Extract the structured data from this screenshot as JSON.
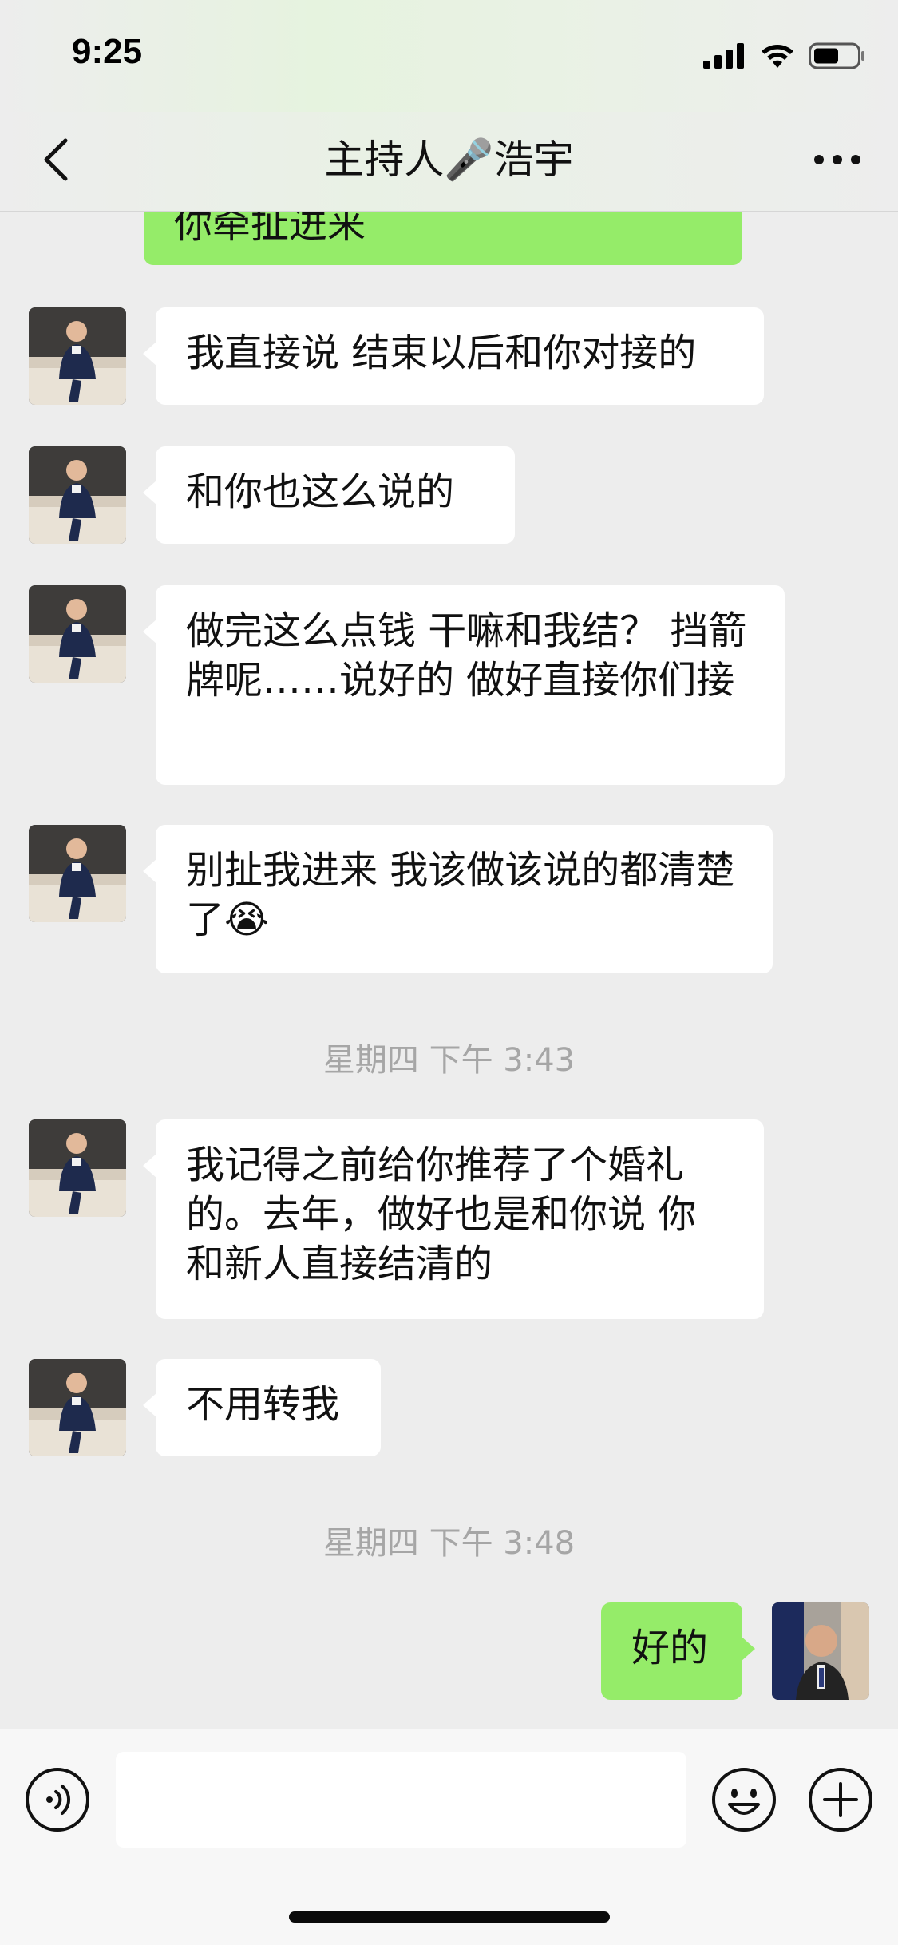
{
  "status_bar": {
    "time": "9:25"
  },
  "nav": {
    "title": "主持人🎤浩宇"
  },
  "messages": [
    {
      "side": "right",
      "text": "你牵扯进来"
    },
    {
      "side": "left",
      "text": "我直接说 结束以后和你对接的"
    },
    {
      "side": "left",
      "text": "和你也这么说的"
    },
    {
      "side": "left",
      "text": "做完这么点钱 干嘛和我结？ 挡箭牌呢……说好的 做好直接你们接"
    },
    {
      "side": "left",
      "text": "别扯我进来  我该做该说的都清楚了😭"
    },
    {
      "side": "left",
      "text": "我记得之前给你推荐了个婚礼的。去年，做好也是和你说 你和新人直接结清的"
    },
    {
      "side": "left",
      "text": "不用转我"
    },
    {
      "side": "right",
      "text": "好的"
    }
  ],
  "timestamps": [
    "星期四 下午 3:43",
    "星期四 下午 3:48"
  ],
  "input": {
    "value": ""
  },
  "colors": {
    "bubble_self": "#95ec69",
    "bubble_other": "#ffffff",
    "background": "#ededed"
  },
  "icons": {
    "back": "chevron-left-icon",
    "more": "more-dots-icon",
    "voice": "voice-icon",
    "emoji": "emoji-icon",
    "plus": "plus-icon"
  }
}
